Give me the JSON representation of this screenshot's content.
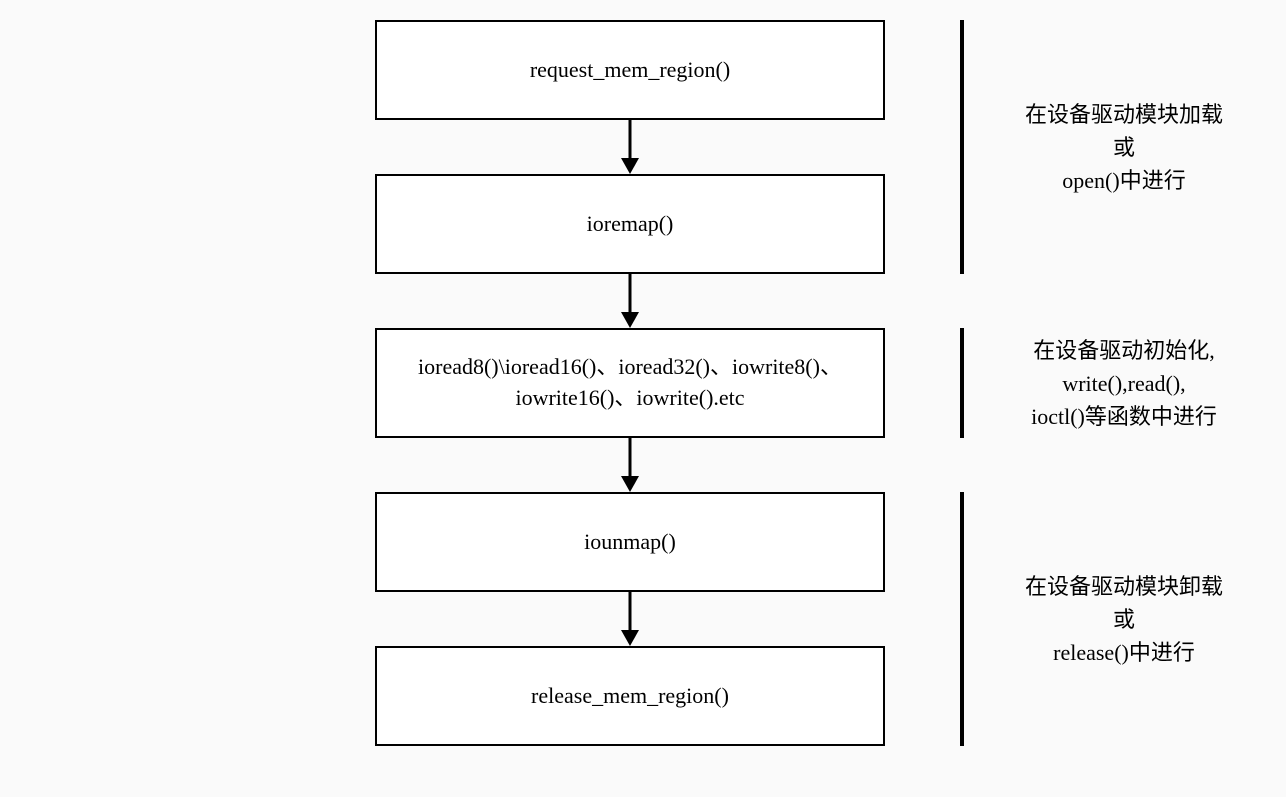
{
  "boxes": {
    "request": "request_mem_region()",
    "ioremap": "ioremap()",
    "io": "ioread8()\\ioread16()、ioread32()、iowrite8()、iowrite16()、iowrite().etc",
    "iounmap": "iounmap()",
    "release": "release_mem_region()"
  },
  "notes": {
    "n1_l1": "在设备驱动模块加载",
    "n1_l2": "或",
    "n1_l3": "open()中进行",
    "n2_l1": "在设备驱动初始化,",
    "n2_l2": "write(),read(),",
    "n2_l3": "ioctl()等函数中进行",
    "n3_l1": "在设备驱动模块卸载",
    "n3_l2": "或",
    "n3_l3": "release()中进行"
  }
}
